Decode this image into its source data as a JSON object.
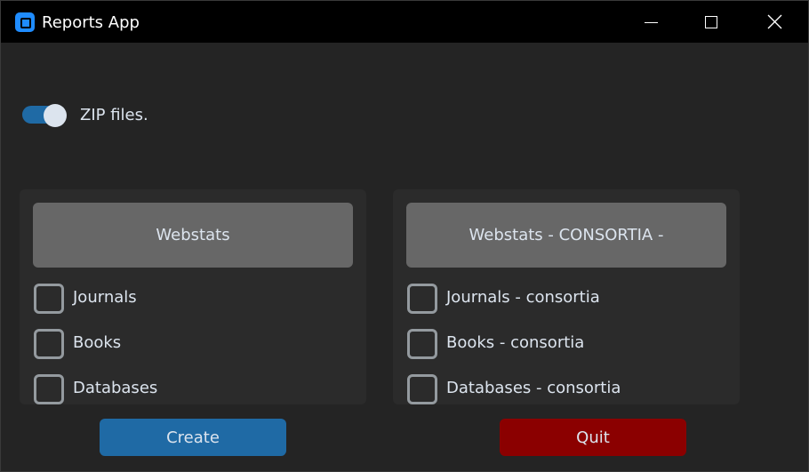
{
  "window": {
    "title": "Reports App",
    "icon": "app-icon",
    "controls": {
      "minimize_icon": "minimize-icon",
      "maximize_icon": "maximize-icon",
      "close_icon": "close-icon"
    }
  },
  "zip_switch": {
    "label": "ZIP files.",
    "checked": true,
    "accent_color": "#1f6aa5"
  },
  "panels": [
    {
      "header": "Webstats",
      "checkboxes": [
        {
          "label": "Journals",
          "checked": false
        },
        {
          "label": "Books",
          "checked": false
        },
        {
          "label": "Databases",
          "checked": false
        }
      ]
    },
    {
      "header": "Webstats - CONSORTIA -",
      "checkboxes": [
        {
          "label": "Journals - consortia",
          "checked": false
        },
        {
          "label": "Books - consortia",
          "checked": false
        },
        {
          "label": "Databases - consortia",
          "checked": false
        }
      ]
    }
  ],
  "buttons": {
    "create": {
      "label": "Create",
      "color": "#1f6aa5"
    },
    "quit": {
      "label": "Quit",
      "color": "#8b0000"
    }
  },
  "colors": {
    "background": "#242424",
    "panel": "#2b2b2b",
    "header_button": "#676767",
    "text": "#dce4ee",
    "checkbox_border": "#949a9f"
  }
}
